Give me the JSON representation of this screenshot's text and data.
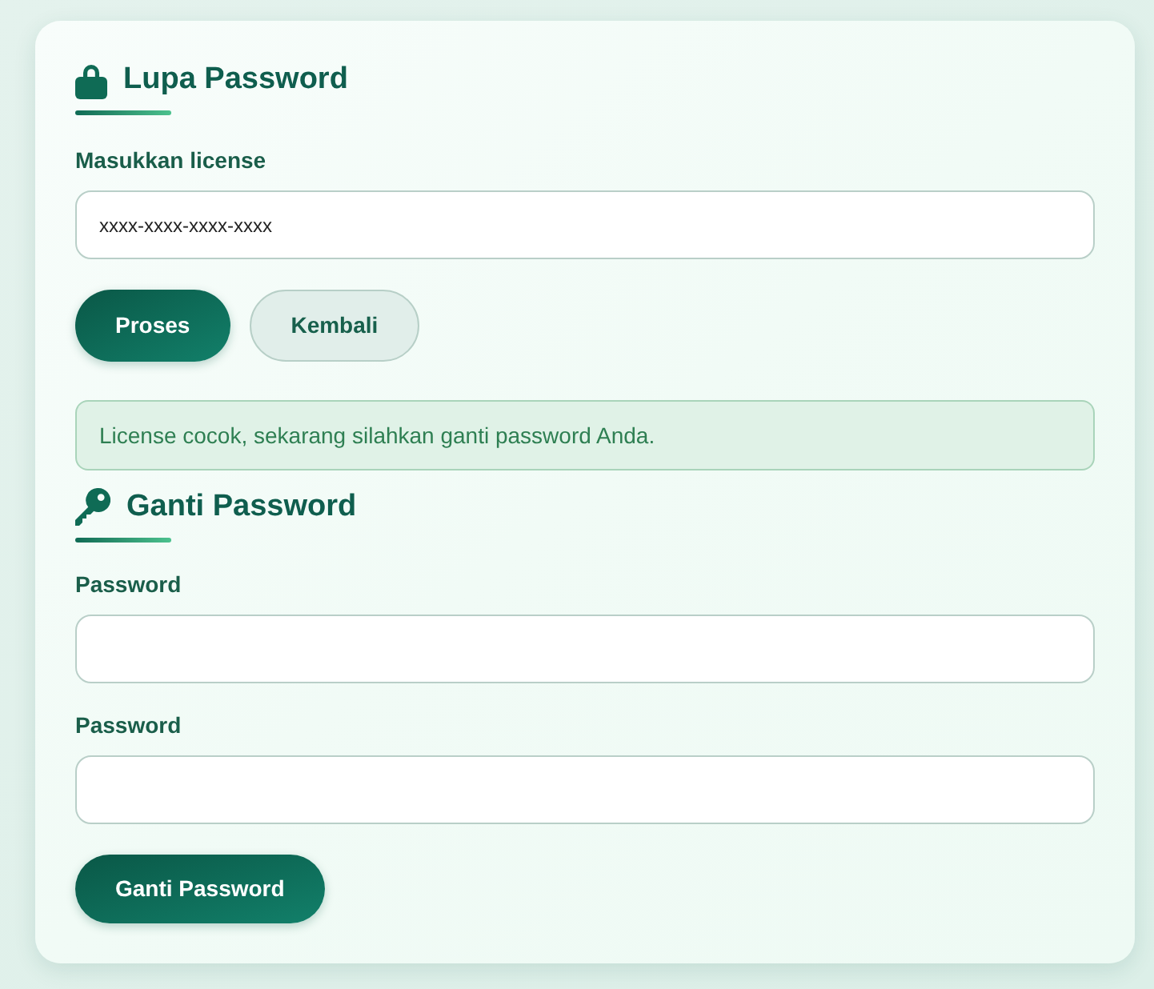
{
  "license_section": {
    "title": "Lupa Password",
    "fields": [
      {
        "label": "Masukkan license",
        "value": "xxxx-xxxx-xxxx-xxxx"
      }
    ],
    "buttons": [
      {
        "label": "Proses",
        "kind": "primary"
      },
      {
        "label": "Kembali",
        "kind": "secondary"
      }
    ]
  },
  "alert": {
    "kind": "success",
    "text": "License cocok, sekarang silahkan ganti password Anda."
  },
  "password_section": {
    "title": "Ganti Password",
    "fields": [
      {
        "label": "Password"
      },
      {
        "label": "Password"
      }
    ],
    "buttons": [
      {
        "label": "Ganti Password",
        "kind": "primary"
      }
    ]
  }
}
